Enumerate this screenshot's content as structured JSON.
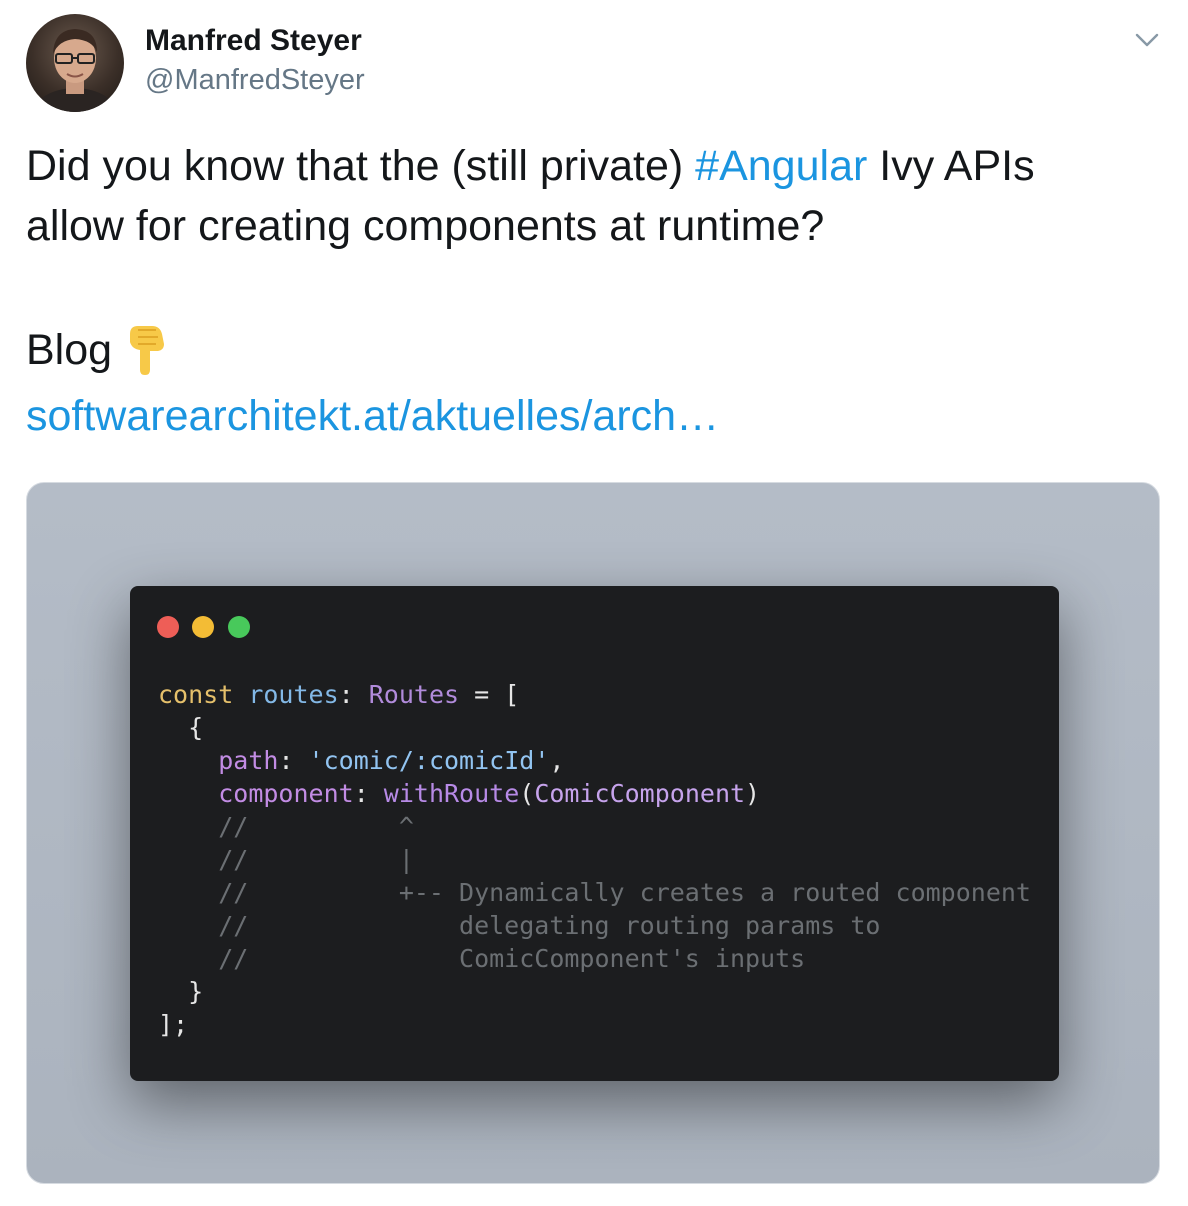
{
  "author": {
    "name": "Manfred Steyer",
    "handle": "@ManfredSteyer"
  },
  "tweet": {
    "line1_before": "Did you know that the (still private) ",
    "hashtag": "#Angular",
    "line1_after": " Ivy APIs",
    "line2": "allow for creating components at runtime?",
    "blog_label": "Blog",
    "emoji": "pointing-down-emoji",
    "link": "softwarearchitekt.at/aktuelles/arch…"
  },
  "code_image": {
    "window_dots": [
      "#ee5e57",
      "#f3bc35",
      "#48c95b"
    ],
    "tokens": {
      "const": "const",
      "routes": "routes",
      "colon1": ": ",
      "Routes": "Routes",
      "eqbracket": " = [",
      "open_brace": "  {",
      "path_key": "path",
      "colon2": ": ",
      "path_val": "'comic/:comicId'",
      "comma": ",",
      "component_key": "component",
      "colon3": ": ",
      "withRoute": "withRoute",
      "paren_open": "(",
      "ComicComponent": "ComicComponent",
      "paren_close": ")",
      "comment1": "    //          ^",
      "comment2": "    //          |",
      "comment3": "    //          +-- Dynamically creates a routed component",
      "comment4": "    //              delegating routing params to",
      "comment5": "    //              ComicComponent's inputs",
      "close_brace": "  }",
      "end": "];"
    }
  },
  "icons": {
    "caret": "chevron-down-icon",
    "avatar": "avatar"
  },
  "colors": {
    "link": "#1b95e0",
    "code_bg": "#1c1d1f",
    "media_bg": "#b4bcc7"
  }
}
